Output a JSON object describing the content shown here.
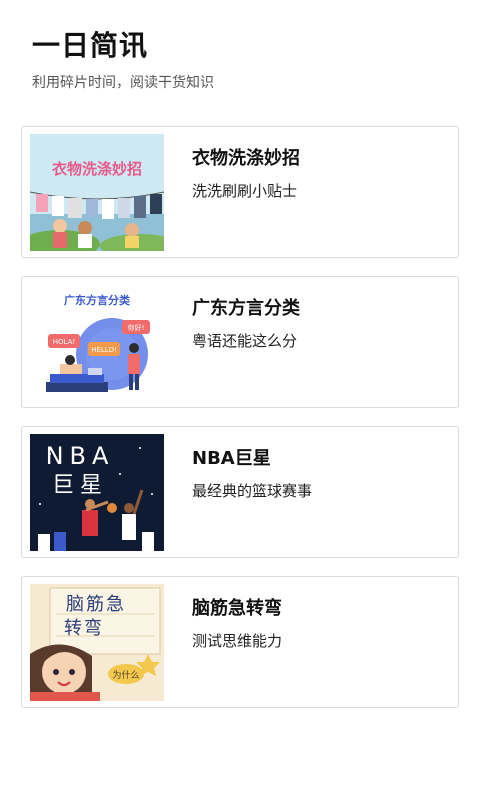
{
  "header": {
    "title": "一日简讯",
    "subtitle": "利用碎片时间，阅读干货知识"
  },
  "cards": [
    {
      "title": "衣物洗涤妙招",
      "subtitle": "洗洗刷刷小贴士",
      "image_text": "衣物洗涤妙招"
    },
    {
      "title": "广东方言分类",
      "subtitle": "粤语还能这么分",
      "image_text": "广东方言分类",
      "bubbles": [
        "HOLA!",
        "你好!",
        "HELLO!"
      ]
    },
    {
      "title": "NBA巨星",
      "subtitle": "最经典的篮球赛事",
      "image_text_1": "NBA",
      "image_text_2": "巨星"
    },
    {
      "title": "脑筋急转弯",
      "subtitle": "测试思维能力",
      "image_text_1": "脑筋急",
      "image_text_2": "转弯",
      "tag": "为什么"
    }
  ]
}
